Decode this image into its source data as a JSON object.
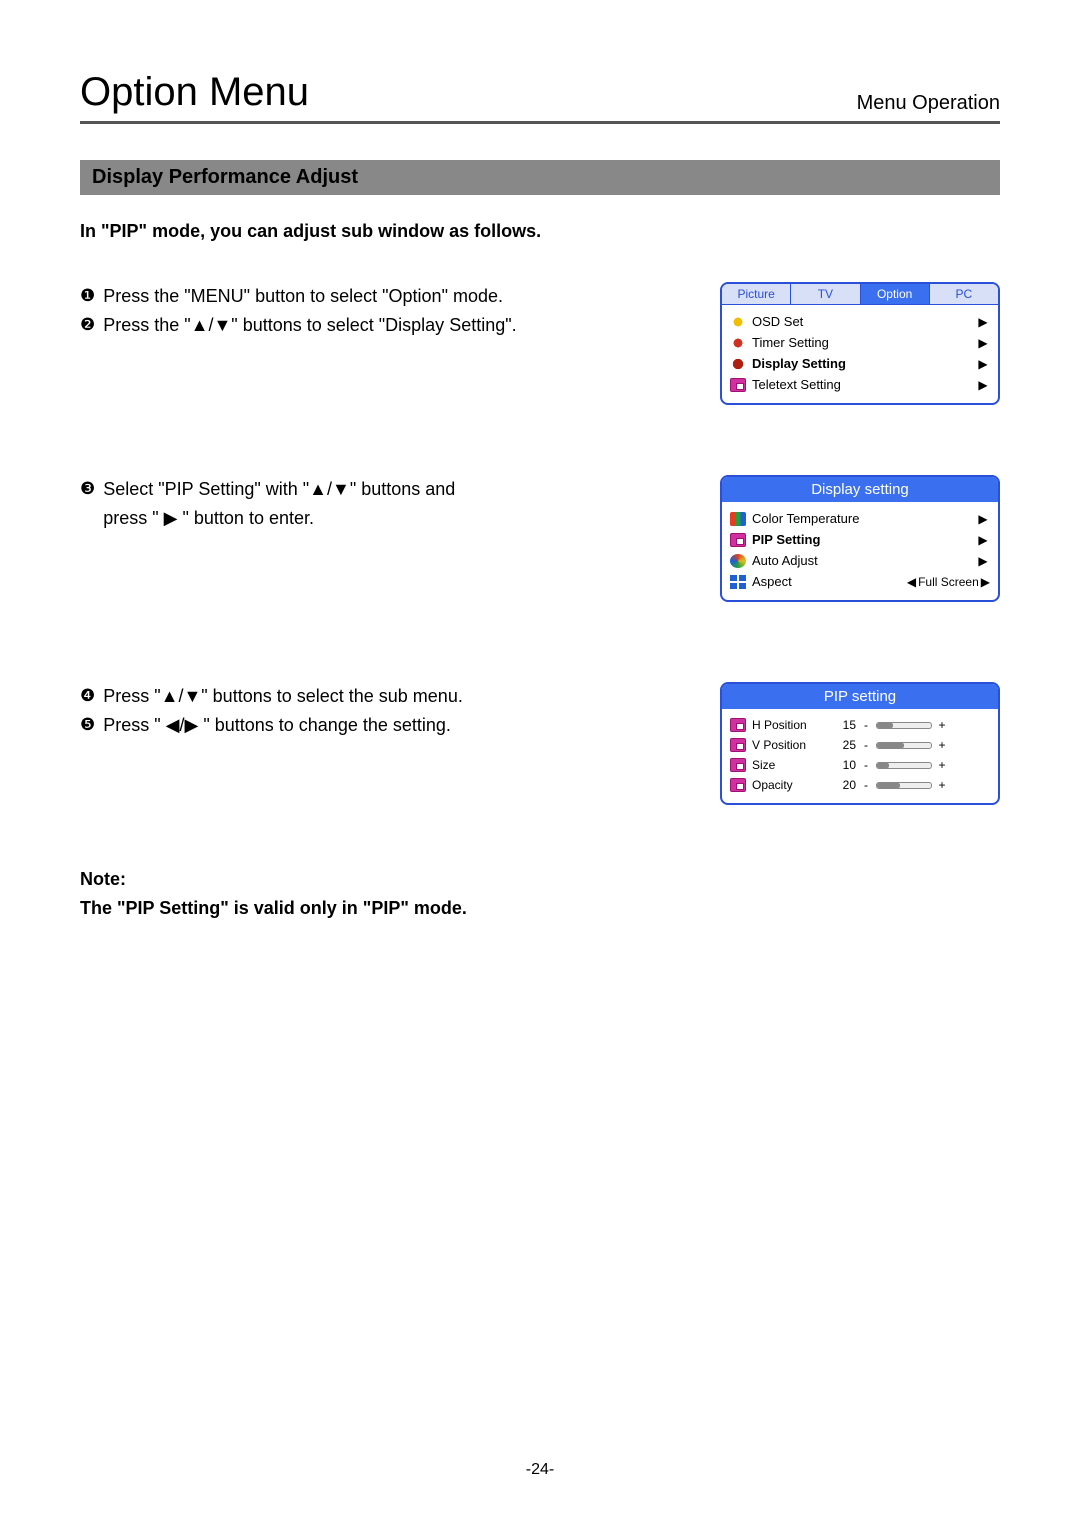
{
  "header": {
    "title": "Option Menu",
    "subtitle": "Menu Operation"
  },
  "section_title": "Display Performance Adjust",
  "intro": "In \"PIP\" mode, you can adjust sub window as follows.",
  "steps": {
    "s1": "Press the \"MENU\" button to select \"Option\" mode.",
    "s2": "Press the \"▲/▼\" buttons to select \"Display Setting\".",
    "s3a": "Select \"PIP Setting\" with \"▲/▼\" buttons and",
    "s3b": "press \" ▶ \" button to enter.",
    "s4": "Press \"▲/▼\" buttons to select the sub menu.",
    "s5": "Press \" ◀/▶ \" buttons to change the setting."
  },
  "note_label": "Note:",
  "note_text": "The \"PIP Setting\" is valid only in \"PIP\" mode.",
  "osd1": {
    "tabs": [
      "Picture",
      "TV",
      "Option",
      "PC"
    ],
    "active_tab": "Option",
    "items": [
      {
        "label": "OSD Set",
        "bold": false
      },
      {
        "label": "Timer Setting",
        "bold": false
      },
      {
        "label": "Display Setting",
        "bold": true
      },
      {
        "label": "Teletext Setting",
        "bold": false
      }
    ]
  },
  "osd2": {
    "title": "Display setting",
    "items": [
      {
        "label": "Color Temperature",
        "value": "",
        "bold": false
      },
      {
        "label": "PIP Setting",
        "value": "",
        "bold": true
      },
      {
        "label": "Auto Adjust",
        "value": "",
        "bold": false
      },
      {
        "label": "Aspect",
        "value": "Full Screen",
        "bold": false
      }
    ]
  },
  "osd3": {
    "title": "PIP setting",
    "items": [
      {
        "label": "H Position",
        "value": 15,
        "pct": 30
      },
      {
        "label": "V Position",
        "value": 25,
        "pct": 50
      },
      {
        "label": "Size",
        "value": 10,
        "pct": 22
      },
      {
        "label": "Opacity",
        "value": 20,
        "pct": 42
      }
    ]
  },
  "page_number": "-24-"
}
